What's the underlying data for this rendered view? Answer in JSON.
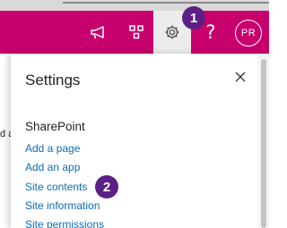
{
  "suite_bar": {
    "icons": [
      "megaphone-icon",
      "app-launcher-icon",
      "gear-icon",
      "help-icon"
    ],
    "help_label": "?",
    "avatar_initials": "PR",
    "brand_color": "#c8006e"
  },
  "background_page": {
    "fragment": "d a"
  },
  "settings_panel": {
    "title": "Settings",
    "section_heading": "SharePoint",
    "links": [
      {
        "label": "Add a page"
      },
      {
        "label": "Add an app"
      },
      {
        "label": "Site contents"
      },
      {
        "label": "Site information"
      },
      {
        "label": "Site permissions"
      }
    ],
    "link_color": "#0b6cb5"
  },
  "callouts": [
    {
      "number": "1",
      "color": "#5b1f85"
    },
    {
      "number": "2",
      "color": "#5b1f85"
    }
  ]
}
